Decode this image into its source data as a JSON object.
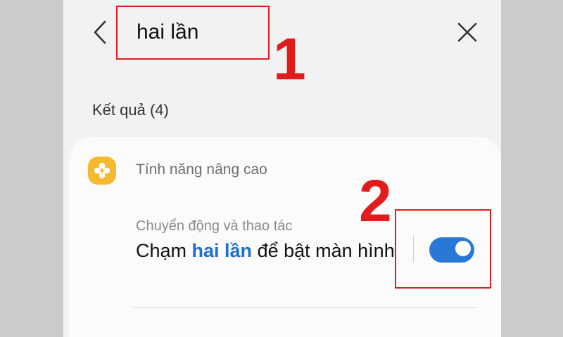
{
  "search": {
    "query": "hai lần"
  },
  "icons": {
    "back": "chevron-left-icon",
    "close": "close-icon",
    "category": "gear-plus-icon"
  },
  "results": {
    "count_label": "Kết quả (4)",
    "items": [
      {
        "category": "Tính năng nâng cao",
        "path": "Chuyển động và thao tác",
        "title_before": "Chạm ",
        "title_highlight": "hai lần",
        "title_after": " để bật màn hình",
        "toggle_on": true
      }
    ]
  },
  "annotations": {
    "label_1": "1",
    "label_2": "2"
  },
  "colors": {
    "highlight": "#1c6fd1",
    "toggle_on": "#2a78d6",
    "category_icon": "#f5b82e",
    "annotation": "#e01c1c"
  }
}
